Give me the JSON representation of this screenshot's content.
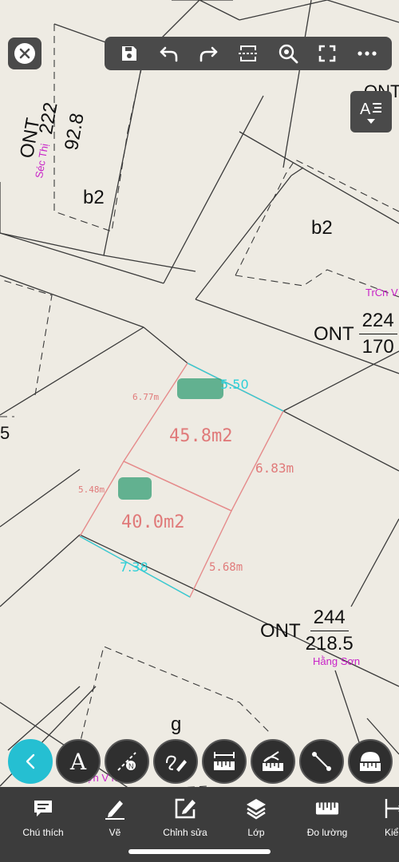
{
  "map": {
    "parcel_labels": {
      "top_left_code": "ONT",
      "top_left_num": "222",
      "top_left_area": "92.8",
      "top_left_owner": "Séc Thị",
      "b2_left": "b2",
      "b2_right": "b2",
      "right_top_code": "ONT",
      "right_top_code_2": "ONT",
      "right_top_num": "224",
      "right_top_area": "170",
      "right_top_owner": "TrCn V",
      "left_edge_digit": "5",
      "bottom_code": "ONT",
      "bottom_num": "244",
      "bottom_area": "218.5",
      "bottom_owner": "Hằng Sơn",
      "g_label": "g",
      "bottom_left_owner": "ợn V nh"
    },
    "measurements": {
      "upper_plot_area": "45.8m2",
      "lower_plot_area": "40.0m2",
      "left_upper_side": "6.77m",
      "left_lower_side": "5.48m",
      "right_upper_side": "6.83m",
      "right_lower_side": "5.68m",
      "top_width": "5.50",
      "bottom_width": "7.38"
    },
    "colors": {
      "background": "#eeebe3",
      "boundary": "#3a3a3a",
      "plot_outline": "#e58b8b",
      "measure_cyan": "#2fd0d8",
      "owner_magenta": "#c822c8",
      "marker_green": "#3fa37a"
    }
  },
  "top_toolbar": {
    "close_icon": "close-icon",
    "buttons": [
      {
        "name": "save-button",
        "icon": "floppy-disk-icon"
      },
      {
        "name": "undo-button",
        "icon": "undo-icon"
      },
      {
        "name": "redo-button",
        "icon": "redo-icon"
      },
      {
        "name": "crop-button",
        "icon": "crop-frame-icon"
      },
      {
        "name": "zoom-search-button",
        "icon": "zoom-search-icon"
      },
      {
        "name": "fullscreen-button",
        "icon": "fullscreen-icon"
      },
      {
        "name": "more-button",
        "icon": "more-dots-icon"
      }
    ],
    "text_style_icon": "text-align-icon"
  },
  "tools": [
    {
      "name": "back-tool",
      "icon": "chevron-left-icon"
    },
    {
      "name": "text-tool",
      "icon": "letter-a-icon",
      "glyph": "A"
    },
    {
      "name": "north-arrow-tool",
      "icon": "north-arrow-icon"
    },
    {
      "name": "freehand-draw-tool",
      "icon": "pen-scribble-icon"
    },
    {
      "name": "measure-distance-tool",
      "icon": "ruler-width-icon"
    },
    {
      "name": "measure-angle-tool",
      "icon": "ruler-angle-icon"
    },
    {
      "name": "line-tool",
      "icon": "line-segment-icon"
    },
    {
      "name": "measure-area-tool",
      "icon": "ruler-area-icon"
    }
  ],
  "bottom_nav": {
    "items": [
      {
        "label": "Chú thích",
        "icon": "comment-icon"
      },
      {
        "label": "Vẽ",
        "icon": "pencil-icon"
      },
      {
        "label": "Chỉnh sửa",
        "icon": "edit-square-icon"
      },
      {
        "label": "Lớp",
        "icon": "layers-icon"
      },
      {
        "label": "Đo lường",
        "icon": "ruler-icon"
      },
      {
        "label": "Kiểu",
        "icon": "style-icon"
      }
    ]
  }
}
